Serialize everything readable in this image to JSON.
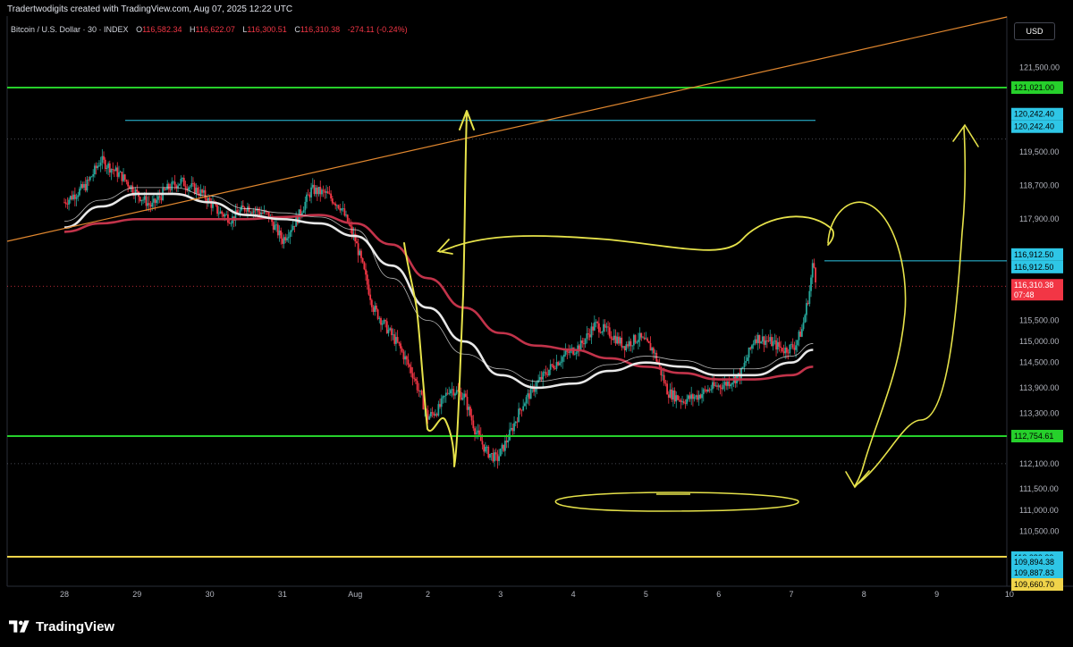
{
  "header": {
    "attribution": "Tradertwodigits created with TradingView.com, Aug 07, 2025 12:22 UTC",
    "symbol": "Bitcoin / U.S. Dollar · 30 · INDEX",
    "open_label": "O",
    "open": "116,582.34",
    "high_label": "H",
    "high": "116,622.07",
    "low_label": "L",
    "low": "116,300.51",
    "close_label": "C",
    "close": "116,310.38",
    "change": "-274.11 (-0.24%)"
  },
  "currency": "USD",
  "brand": {
    "name": "TradingView",
    "logo_icon": "tradingview-logo-icon"
  },
  "colors": {
    "up": "#26a69a",
    "down": "#f23645",
    "ma_white": "#e8e8e8",
    "ma_red": "#c2334a",
    "support_green": "#26d02b",
    "cyan": "#2ec6e6",
    "trend_orange": "#e0872f",
    "drawing_yellow": "#e6e24a",
    "bottom_yellow": "#f0d44a"
  },
  "chart_data": {
    "type": "candlestick",
    "x_ticks": [
      "28",
      "29",
      "30",
      "31",
      "Aug",
      "2",
      "3",
      "4",
      "5",
      "6",
      "7",
      "8",
      "9",
      "10"
    ],
    "y_ticks": [
      "121,500.00",
      "119,500.00",
      "118,700.00",
      "117,900.00",
      "115,500.00",
      "115,000.00",
      "114,500.00",
      "113,900.00",
      "113,300.00",
      "112,100.00",
      "111,500.00",
      "111,000.00",
      "110,500.00"
    ],
    "ylim": [
      109700,
      122600
    ],
    "price_path": [
      [
        0,
        118300
      ],
      [
        0.3,
        118700
      ],
      [
        0.5,
        119300
      ],
      [
        0.8,
        118900
      ],
      [
        1.0,
        118500
      ],
      [
        1.2,
        118200
      ],
      [
        1.4,
        118600
      ],
      [
        1.6,
        118800
      ],
      [
        1.9,
        118500
      ],
      [
        2.1,
        118100
      ],
      [
        2.3,
        117900
      ],
      [
        2.5,
        118200
      ],
      [
        2.8,
        118000
      ],
      [
        3.0,
        117400
      ],
      [
        3.2,
        117900
      ],
      [
        3.4,
        118600
      ],
      [
        3.6,
        118500
      ],
      [
        3.8,
        118200
      ],
      [
        4.0,
        117400
      ],
      [
        4.1,
        116800
      ],
      [
        4.25,
        115800
      ],
      [
        4.4,
        115400
      ],
      [
        4.6,
        114900
      ],
      [
        4.8,
        114200
      ],
      [
        5.0,
        113200
      ],
      [
        5.15,
        113400
      ],
      [
        5.3,
        113900
      ],
      [
        5.5,
        113700
      ],
      [
        5.65,
        112900
      ],
      [
        5.8,
        112400
      ],
      [
        5.95,
        112200
      ],
      [
        6.1,
        112700
      ],
      [
        6.3,
        113500
      ],
      [
        6.5,
        114000
      ],
      [
        6.7,
        114400
      ],
      [
        6.9,
        114700
      ],
      [
        7.1,
        114900
      ],
      [
        7.3,
        115400
      ],
      [
        7.5,
        115200
      ],
      [
        7.7,
        114900
      ],
      [
        7.9,
        115100
      ],
      [
        8.1,
        114800
      ],
      [
        8.3,
        113800
      ],
      [
        8.5,
        113600
      ],
      [
        8.7,
        113700
      ],
      [
        8.9,
        113900
      ],
      [
        9.1,
        114000
      ],
      [
        9.3,
        114200
      ],
      [
        9.5,
        115100
      ],
      [
        9.7,
        115000
      ],
      [
        9.9,
        114800
      ],
      [
        10.05,
        114900
      ],
      [
        10.15,
        115300
      ],
      [
        10.25,
        116200
      ],
      [
        10.3,
        116900
      ],
      [
        10.35,
        116310
      ]
    ],
    "ma_white": [
      [
        0,
        117700
      ],
      [
        0.5,
        118200
      ],
      [
        1.0,
        118500
      ],
      [
        1.5,
        118500
      ],
      [
        2.0,
        118300
      ],
      [
        2.5,
        118000
      ],
      [
        3.0,
        117900
      ],
      [
        3.5,
        117800
      ],
      [
        4.0,
        117500
      ],
      [
        4.5,
        116800
      ],
      [
        5.0,
        115800
      ],
      [
        5.5,
        115000
      ],
      [
        6.0,
        114200
      ],
      [
        6.5,
        113900
      ],
      [
        7.0,
        114000
      ],
      [
        7.5,
        114300
      ],
      [
        8.0,
        114500
      ],
      [
        8.5,
        114400
      ],
      [
        9.0,
        114200
      ],
      [
        9.5,
        114200
      ],
      [
        10.0,
        114500
      ],
      [
        10.3,
        114800
      ]
    ],
    "ma_red": [
      [
        0,
        117600
      ],
      [
        0.5,
        117800
      ],
      [
        1.0,
        117900
      ],
      [
        1.5,
        117900
      ],
      [
        2.0,
        117900
      ],
      [
        2.5,
        117900
      ],
      [
        3.0,
        117950
      ],
      [
        3.5,
        118000
      ],
      [
        4.0,
        117800
      ],
      [
        4.5,
        117300
      ],
      [
        5.0,
        116500
      ],
      [
        5.5,
        115800
      ],
      [
        6.0,
        115200
      ],
      [
        6.5,
        114900
      ],
      [
        7.0,
        114800
      ],
      [
        7.5,
        114600
      ],
      [
        8.0,
        114400
      ],
      [
        8.5,
        114250
      ],
      [
        9.0,
        114100
      ],
      [
        9.5,
        114100
      ],
      [
        10.0,
        114200
      ],
      [
        10.3,
        114400
      ]
    ],
    "horizontal_levels": [
      {
        "price": 121021.0,
        "label": "121,021.00",
        "style": "green"
      },
      {
        "price": 120242.4,
        "label": "120,242.40",
        "style": "cyan"
      },
      {
        "price": 116912.5,
        "label": "116,912.50",
        "style": "cyan"
      },
      {
        "price": 112754.61,
        "label": "112,754.61",
        "style": "green"
      },
      {
        "price": 109894.38,
        "label": "109,894.38",
        "style": "yellow"
      }
    ],
    "stacked_labels": [
      {
        "price": 120242.4,
        "label": "120,242.40"
      },
      {
        "price": 116912.5,
        "label": "116,912.50"
      },
      {
        "price": 109887.83,
        "label": "109,887.83"
      },
      {
        "price": 110090.0,
        "label": "110,090.00"
      },
      {
        "price": 109660.7,
        "label": "109,660.70"
      }
    ],
    "current_price": {
      "price": 116310.38,
      "label": "116,310.38",
      "countdown": "07:48"
    }
  }
}
